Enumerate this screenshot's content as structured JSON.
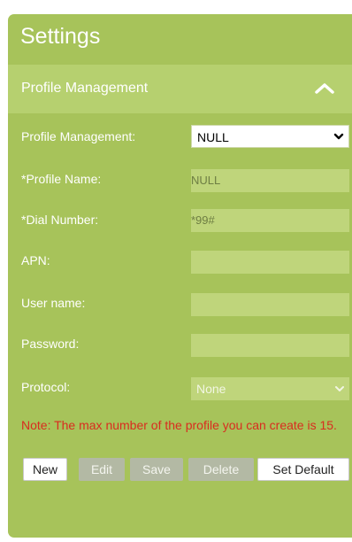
{
  "panel": {
    "title": "Settings"
  },
  "section": {
    "title": "Profile Management",
    "collapse_icon": "chevron-up-icon"
  },
  "form": {
    "profile_management": {
      "label": "Profile Management:",
      "value": "NULL"
    },
    "profile_name": {
      "label": "*Profile Name:",
      "value": "NULL"
    },
    "dial_number": {
      "label": "*Dial Number:",
      "value": "*99#"
    },
    "apn": {
      "label": "APN:",
      "value": ""
    },
    "user_name": {
      "label": "User name:",
      "value": ""
    },
    "password": {
      "label": "Password:",
      "value": ""
    },
    "protocol": {
      "label": "Protocol:",
      "value": "None"
    }
  },
  "note": "Note: The max number of the profile you can create is 15.",
  "buttons": {
    "new": "New",
    "edit": "Edit",
    "save": "Save",
    "delete": "Delete",
    "set_default": "Set Default"
  },
  "colors": {
    "panel_bg": "#a7c35a",
    "section_bg": "#b6d06f",
    "field_bg": "#bfd57b",
    "note_text": "#d92c1f"
  }
}
